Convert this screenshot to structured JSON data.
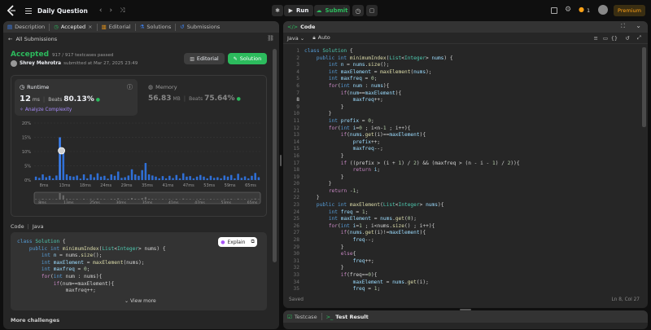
{
  "topbar": {
    "problem_list": "Daily Question",
    "run": "Run",
    "submit": "Submit",
    "premium": "Premium",
    "streak": "1"
  },
  "left": {
    "tabs": [
      "Description",
      "Accepted",
      "Editorial",
      "Solutions",
      "Submissions"
    ],
    "back": "All Submissions",
    "status": "Accepted",
    "testcases": "917 / 917 testcases passed",
    "user": "Shrey Mehrotra",
    "submitted": "submitted at Mar 27, 2025 23:49",
    "editorial_btn": "Editorial",
    "solution_btn": "Solution",
    "runtime_label": "Runtime",
    "runtime_val": "12",
    "runtime_unit": "ms",
    "beats_label": "Beats",
    "runtime_beats": "80.13%",
    "analyze": "Analyze Complexity",
    "memory_label": "Memory",
    "memory_val": "56.83",
    "memory_unit": "MB",
    "memory_beats": "75.64%",
    "y_ticks": [
      "20%",
      "15%",
      "10%",
      "5%",
      "0%"
    ],
    "x_ticks": [
      "8ms",
      "13ms",
      "18ms",
      "24ms",
      "29ms",
      "35ms",
      "41ms",
      "47ms",
      "53ms",
      "59ms",
      "65ms"
    ],
    "mini_ticks": [
      "8ms",
      "13ms",
      "25ms",
      "30ms",
      "35ms",
      "41ms",
      "47ms",
      "53ms",
      "65ms"
    ],
    "code_header": "Code",
    "lang": "Java",
    "explain": "Explain",
    "view_more": "View more",
    "more_challenges": "More challenges"
  },
  "chart_data": {
    "type": "bar",
    "ylim": [
      0,
      20
    ],
    "y_ticks": [
      "20%",
      "15%",
      "10%",
      "5%",
      "0%"
    ],
    "x_ticks": [
      "8ms",
      "13ms",
      "18ms",
      "24ms",
      "29ms",
      "35ms",
      "41ms",
      "47ms",
      "53ms",
      "59ms",
      "65ms"
    ],
    "values": [
      1.2,
      0.8,
      2,
      1,
      1.5,
      0.6,
      1.6,
      15,
      10,
      2,
      1.4,
      1.2,
      1.6,
      0.5,
      2,
      0.6,
      2,
      1,
      2.4,
      1.2,
      1.5,
      0.5,
      2,
      1.5,
      3,
      0.8,
      1,
      1.6,
      3.8,
      2,
      1.5,
      3.5,
      6,
      2,
      1.6,
      1.2,
      0.6,
      1.4,
      0.6,
      1.5,
      0.7,
      1.8,
      0.6,
      2.4,
      1.2,
      1.4,
      0.6,
      1.2,
      1.8,
      1.2,
      0.6,
      1.5,
      0.8,
      1,
      0.6,
      1.6,
      1.2,
      1.8,
      0.6,
      2.2,
      0.8,
      1.3,
      0.6,
      1.5,
      2.5,
      1
    ],
    "highlight_index": 7
  },
  "right": {
    "title": "Code",
    "lang": "Java",
    "mode": "Auto",
    "saved": "Saved",
    "cursor": "Ln 8, Col 27",
    "testcase": "Testcase",
    "test_result": "Test Result"
  },
  "editor_lines": [
    [
      [
        "kw",
        "class "
      ],
      [
        "tp",
        "Solution"
      ],
      [
        "pl",
        " {"
      ]
    ],
    [
      [
        "pl",
        "    "
      ],
      [
        "kw",
        "public int "
      ],
      [
        "fn",
        "minimumIndex"
      ],
      [
        "pl",
        "("
      ],
      [
        "tp",
        "List"
      ],
      [
        "pl",
        "<"
      ],
      [
        "tp",
        "Integer"
      ],
      [
        "pl",
        "> "
      ],
      [
        "var",
        "nums"
      ],
      [
        "pl",
        ") {"
      ]
    ],
    [
      [
        "pl",
        "        "
      ],
      [
        "kw",
        "int "
      ],
      [
        "var",
        "n"
      ],
      [
        "pl",
        " = "
      ],
      [
        "var",
        "nums"
      ],
      [
        "pl",
        "."
      ],
      [
        "fn",
        "size"
      ],
      [
        "pl",
        "();"
      ]
    ],
    [
      [
        "pl",
        "        "
      ],
      [
        "kw",
        "int "
      ],
      [
        "var",
        "maxElement"
      ],
      [
        "pl",
        " = "
      ],
      [
        "fn",
        "maxElement"
      ],
      [
        "pl",
        "("
      ],
      [
        "var",
        "nums"
      ],
      [
        "pl",
        ");"
      ]
    ],
    [
      [
        "pl",
        "        "
      ],
      [
        "kw",
        "int "
      ],
      [
        "var",
        "maxfreq"
      ],
      [
        "pl",
        " = "
      ],
      [
        "num",
        "0"
      ],
      [
        "pl",
        ";"
      ]
    ],
    [
      [
        "pl",
        "        "
      ],
      [
        "ctl",
        "for"
      ],
      [
        "pl",
        "("
      ],
      [
        "kw",
        "int "
      ],
      [
        "var",
        "num"
      ],
      [
        "pl",
        " : "
      ],
      [
        "var",
        "nums"
      ],
      [
        "pl",
        "){"
      ]
    ],
    [
      [
        "pl",
        "            "
      ],
      [
        "ctl",
        "if"
      ],
      [
        "pl",
        "("
      ],
      [
        "var",
        "num"
      ],
      [
        "pl",
        "=="
      ],
      [
        "var",
        "maxElement"
      ],
      [
        "pl",
        "){"
      ]
    ],
    [
      [
        "pl",
        "                "
      ],
      [
        "var",
        "maxfreq"
      ],
      [
        "pl",
        "++;"
      ]
    ],
    [
      [
        "pl",
        "            }"
      ]
    ],
    [
      [
        "pl",
        "        }"
      ]
    ],
    [
      [
        "pl",
        "        "
      ],
      [
        "kw",
        "int "
      ],
      [
        "var",
        "prefix"
      ],
      [
        "pl",
        " = "
      ],
      [
        "num",
        "0"
      ],
      [
        "pl",
        ";"
      ]
    ],
    [
      [
        "pl",
        "        "
      ],
      [
        "ctl",
        "for"
      ],
      [
        "pl",
        "("
      ],
      [
        "kw",
        "int "
      ],
      [
        "var",
        "i"
      ],
      [
        "pl",
        "="
      ],
      [
        "num",
        "0"
      ],
      [
        "pl",
        " ; i<n-"
      ],
      [
        "num",
        "1"
      ],
      [
        "pl",
        " ; i++){"
      ]
    ],
    [
      [
        "pl",
        "            "
      ],
      [
        "ctl",
        "if"
      ],
      [
        "pl",
        "("
      ],
      [
        "var",
        "nums"
      ],
      [
        "pl",
        "."
      ],
      [
        "fn",
        "get"
      ],
      [
        "pl",
        "(i)=="
      ],
      [
        "var",
        "maxElement"
      ],
      [
        "pl",
        "){"
      ]
    ],
    [
      [
        "pl",
        "                "
      ],
      [
        "var",
        "prefix"
      ],
      [
        "pl",
        "++;"
      ]
    ],
    [
      [
        "pl",
        "                "
      ],
      [
        "var",
        "maxfreq"
      ],
      [
        "pl",
        "--;"
      ]
    ],
    [
      [
        "pl",
        "            }"
      ]
    ],
    [
      [
        "pl",
        "            "
      ],
      [
        "ctl",
        "if"
      ],
      [
        "pl",
        " ((prefix > (i + "
      ],
      [
        "num",
        "1"
      ],
      [
        "pl",
        ") / "
      ],
      [
        "num",
        "2"
      ],
      [
        "pl",
        ") && (maxfreq > (n - i - "
      ],
      [
        "num",
        "1"
      ],
      [
        "pl",
        ") / "
      ],
      [
        "num",
        "2"
      ],
      [
        "pl",
        ")){"
      ]
    ],
    [
      [
        "pl",
        "                "
      ],
      [
        "ctl",
        "return "
      ],
      [
        "var",
        "i"
      ],
      [
        "pl",
        ";"
      ]
    ],
    [
      [
        "pl",
        "            }"
      ]
    ],
    [
      [
        "pl",
        "        }"
      ]
    ],
    [
      [
        "pl",
        "        "
      ],
      [
        "ctl",
        "return "
      ],
      [
        "pl",
        "-"
      ],
      [
        "num",
        "1"
      ],
      [
        "pl",
        ";"
      ]
    ],
    [
      [
        "pl",
        "    }"
      ]
    ],
    [
      [
        "pl",
        "    "
      ],
      [
        "kw",
        "public int "
      ],
      [
        "fn",
        "maxElement"
      ],
      [
        "pl",
        "("
      ],
      [
        "tp",
        "List"
      ],
      [
        "pl",
        "<"
      ],
      [
        "tp",
        "Integer"
      ],
      [
        "pl",
        "> "
      ],
      [
        "var",
        "nums"
      ],
      [
        "pl",
        "){"
      ]
    ],
    [
      [
        "pl",
        "        "
      ],
      [
        "kw",
        "int "
      ],
      [
        "var",
        "freq"
      ],
      [
        "pl",
        " = "
      ],
      [
        "num",
        "1"
      ],
      [
        "pl",
        ";"
      ]
    ],
    [
      [
        "pl",
        "        "
      ],
      [
        "kw",
        "int "
      ],
      [
        "var",
        "maxElement"
      ],
      [
        "pl",
        " = "
      ],
      [
        "var",
        "nums"
      ],
      [
        "pl",
        "."
      ],
      [
        "fn",
        "get"
      ],
      [
        "pl",
        "("
      ],
      [
        "num",
        "0"
      ],
      [
        "pl",
        ");"
      ]
    ],
    [
      [
        "pl",
        "        "
      ],
      [
        "ctl",
        "for"
      ],
      [
        "pl",
        "("
      ],
      [
        "kw",
        "int "
      ],
      [
        "var",
        "i"
      ],
      [
        "pl",
        "="
      ],
      [
        "num",
        "1"
      ],
      [
        "pl",
        " ; i<nums."
      ],
      [
        "fn",
        "size"
      ],
      [
        "pl",
        "() ; i++){"
      ]
    ],
    [
      [
        "pl",
        "            "
      ],
      [
        "ctl",
        "if"
      ],
      [
        "pl",
        "("
      ],
      [
        "var",
        "nums"
      ],
      [
        "pl",
        "."
      ],
      [
        "fn",
        "get"
      ],
      [
        "pl",
        "(i)!="
      ],
      [
        "var",
        "maxElement"
      ],
      [
        "pl",
        "){"
      ]
    ],
    [
      [
        "pl",
        "                "
      ],
      [
        "var",
        "freq"
      ],
      [
        "pl",
        "--;"
      ]
    ],
    [
      [
        "pl",
        "            }"
      ]
    ],
    [
      [
        "pl",
        "            "
      ],
      [
        "ctl",
        "else"
      ],
      [
        "pl",
        "{"
      ]
    ],
    [
      [
        "pl",
        "                "
      ],
      [
        "var",
        "freq"
      ],
      [
        "pl",
        "++;"
      ]
    ],
    [
      [
        "pl",
        "            }"
      ]
    ],
    [
      [
        "pl",
        "            "
      ],
      [
        "ctl",
        "if"
      ],
      [
        "pl",
        "(freq=="
      ],
      [
        "num",
        "0"
      ],
      [
        "pl",
        "){"
      ]
    ],
    [
      [
        "pl",
        "                "
      ],
      [
        "var",
        "maxElement"
      ],
      [
        "pl",
        " = "
      ],
      [
        "var",
        "nums"
      ],
      [
        "pl",
        "."
      ],
      [
        "fn",
        "get"
      ],
      [
        "pl",
        "(i);"
      ]
    ],
    [
      [
        "pl",
        "                "
      ],
      [
        "var",
        "freq"
      ],
      [
        "pl",
        " = "
      ],
      [
        "num",
        "1"
      ],
      [
        "pl",
        ";"
      ]
    ],
    [
      [
        "pl",
        "            }"
      ]
    ]
  ],
  "code_lines": [
    [
      [
        "kw",
        "class "
      ],
      [
        "tp",
        "Solution"
      ],
      [
        "pl",
        " {"
      ]
    ],
    [
      [
        "pl",
        "    "
      ],
      [
        "kw",
        "public int "
      ],
      [
        "fn",
        "minimumIndex"
      ],
      [
        "pl",
        "("
      ],
      [
        "tp",
        "List"
      ],
      [
        "pl",
        "<"
      ],
      [
        "tp",
        "Integer"
      ],
      [
        "pl",
        "> nums) {"
      ]
    ],
    [
      [
        "pl",
        "        "
      ],
      [
        "kw",
        "int "
      ],
      [
        "var",
        "n"
      ],
      [
        "pl",
        " = nums."
      ],
      [
        "fn",
        "size"
      ],
      [
        "pl",
        "();"
      ]
    ],
    [
      [
        "pl",
        "        "
      ],
      [
        "kw",
        "int "
      ],
      [
        "var",
        "maxElement"
      ],
      [
        "pl",
        " = "
      ],
      [
        "fn",
        "maxElement"
      ],
      [
        "pl",
        "(nums);"
      ]
    ],
    [
      [
        "pl",
        "        "
      ],
      [
        "kw",
        "int "
      ],
      [
        "var",
        "maxfreq"
      ],
      [
        "pl",
        " = "
      ],
      [
        "num",
        "0"
      ],
      [
        "pl",
        ";"
      ]
    ],
    [
      [
        "pl",
        "        "
      ],
      [
        "ctl",
        "for"
      ],
      [
        "pl",
        "("
      ],
      [
        "kw",
        "int "
      ],
      [
        "pl",
        "num : nums){"
      ]
    ],
    [
      [
        "pl",
        "            "
      ],
      [
        "ctl",
        "if"
      ],
      [
        "pl",
        "(num==maxElement){"
      ]
    ],
    [
      [
        "pl",
        "                maxfreq++;"
      ]
    ]
  ]
}
